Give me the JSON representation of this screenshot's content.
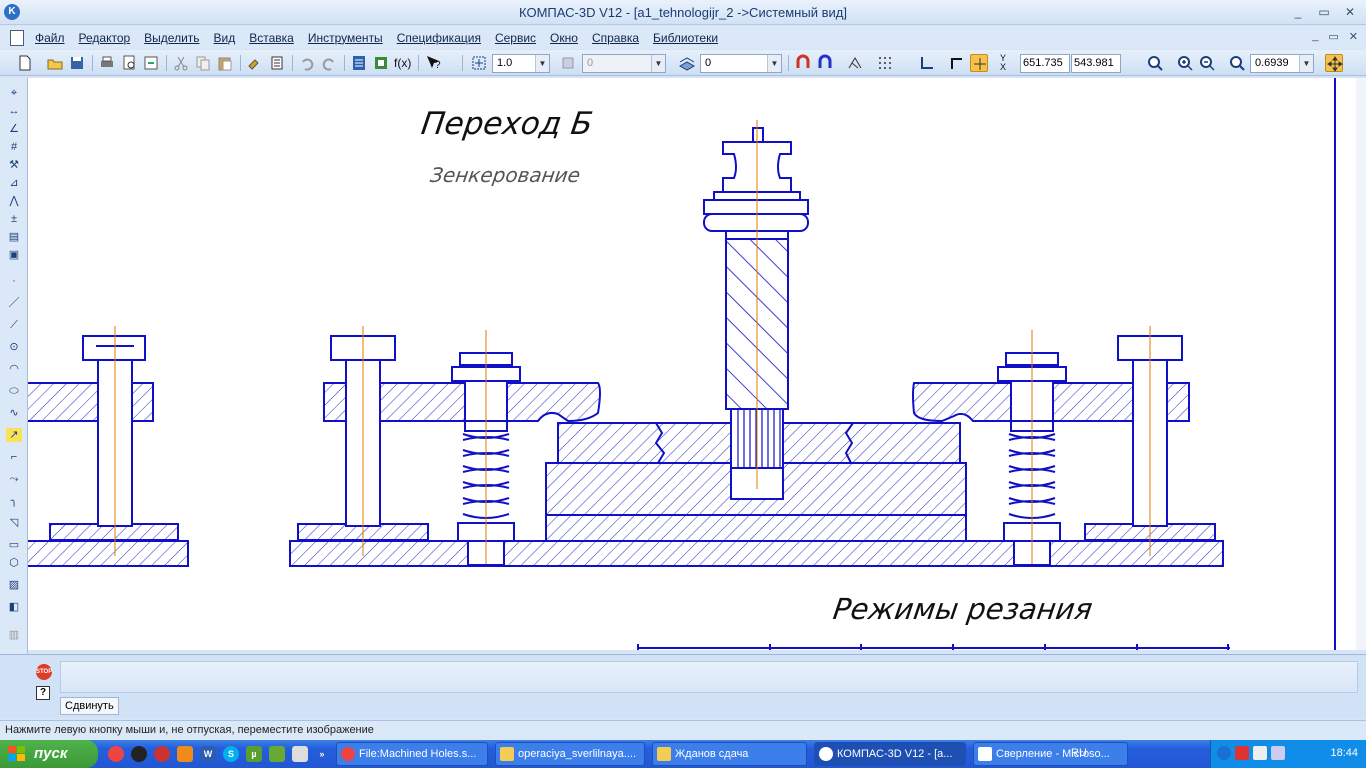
{
  "window": {
    "title": "КОМПАС-3D V12 - [a1_tehnologijr_2 ->Системный вид]",
    "app_icon": "kompas-icon"
  },
  "window_buttons": [
    "_",
    "▭",
    "✕"
  ],
  "doc_buttons": [
    "_",
    "▭",
    "✕"
  ],
  "menu": [
    "Файл",
    "Редактор",
    "Выделить",
    "Вид",
    "Вставка",
    "Инструменты",
    "Спецификация",
    "Сервис",
    "Окно",
    "Справка",
    "Библиотеки"
  ],
  "toolbar": {
    "scale_value": "1.0",
    "layer_value": "0",
    "style_value": "0",
    "coord_x": "651.735",
    "coord_y": "543.981",
    "zoom_value": "0.6939",
    "fx_label": "f(x)"
  },
  "drawing": {
    "heading": "Переход Б",
    "subheading": "Зенкерование",
    "section_title": "Режимы резания"
  },
  "command": {
    "tab_label": "Сдвинуть"
  },
  "status": {
    "hint": "Нажмите левую кнопку мыши и, не отпуская, переместите изображение"
  },
  "taskbar": {
    "start_label": "пуск",
    "tasks": [
      {
        "label": "File:Machined Holes.s...",
        "icon": "chrome-icon"
      },
      {
        "label": "operaciya_sverlilnaya....",
        "icon": "folder-icon"
      },
      {
        "label": "Жданов сдача",
        "icon": "folder-icon"
      },
      {
        "label": "КОМПАС-3D V12 - [a...",
        "icon": "kompas-icon"
      },
      {
        "label": "Сверление - Microso...",
        "icon": "word-icon"
      }
    ],
    "lang": "RU",
    "clock": "18:44"
  },
  "colors": {
    "drawing_line": "#1010c8",
    "axis_line": "#e07b00",
    "taskbar": "#245edb",
    "start": "#3b9a37"
  }
}
